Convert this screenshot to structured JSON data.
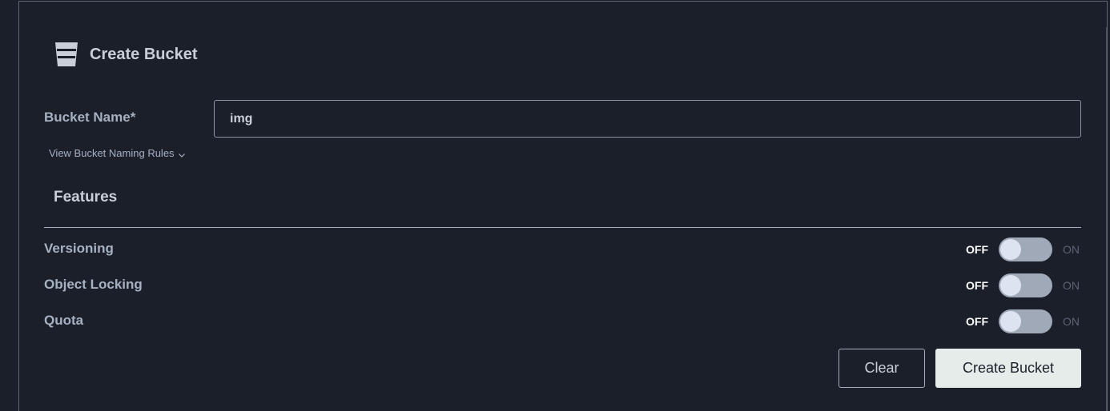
{
  "header": {
    "title": "Create Bucket",
    "icon": "bucket-icon"
  },
  "bucket_name": {
    "label": "Bucket Name*",
    "value": "img"
  },
  "naming_rules": {
    "label": "View Bucket Naming Rules"
  },
  "features": {
    "title": "Features",
    "items": [
      {
        "label": "Versioning",
        "off_label": "OFF",
        "on_label": "ON",
        "state": "off"
      },
      {
        "label": "Object Locking",
        "off_label": "OFF",
        "on_label": "ON",
        "state": "off"
      },
      {
        "label": "Quota",
        "off_label": "OFF",
        "on_label": "ON",
        "state": "off"
      }
    ]
  },
  "actions": {
    "clear_label": "Clear",
    "create_label": "Create Bucket"
  },
  "colors": {
    "background": "#1a1f2a",
    "primary_button": "#e6ecea",
    "toggle_track": "#a0a9b8",
    "toggle_knob": "#dde3f0"
  }
}
